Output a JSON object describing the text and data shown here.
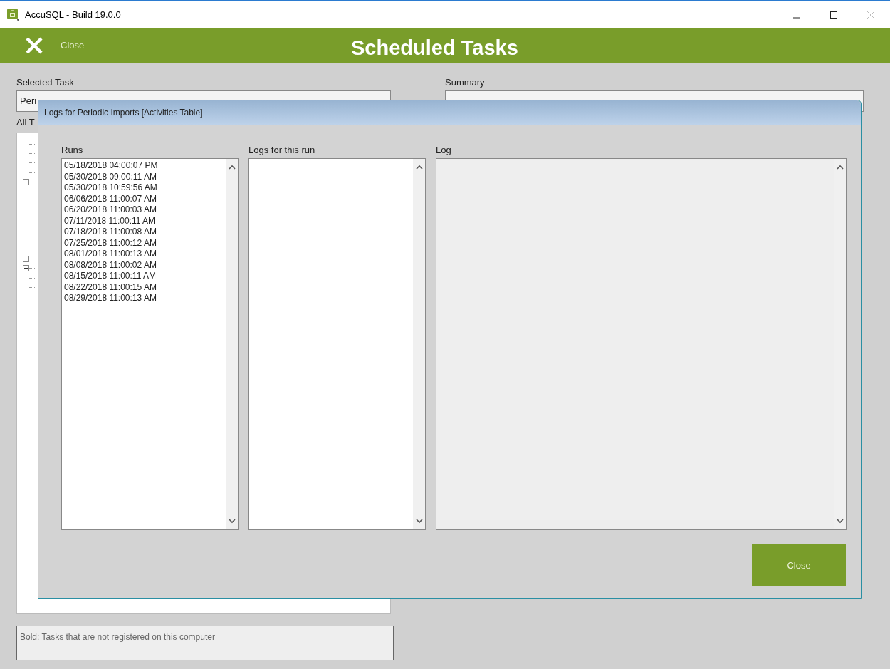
{
  "window": {
    "title": "AccuSQL - Build 19.0.0"
  },
  "header": {
    "close_label": "Close",
    "title": "Scheduled Tasks"
  },
  "selected_task": {
    "label": "Selected Task",
    "value": "Peri"
  },
  "all_tasks": {
    "label": "All T",
    "items": [
      {
        "kind": "leaf"
      },
      {
        "kind": "leaf"
      },
      {
        "kind": "leaf"
      },
      {
        "kind": "leaf"
      },
      {
        "kind": "expanded"
      },
      {
        "kind": "collapsed"
      },
      {
        "kind": "collapsed"
      },
      {
        "kind": "leaf"
      },
      {
        "kind": "leaf"
      }
    ]
  },
  "summary": {
    "label": "Summary"
  },
  "legend": "Bold: Tasks that are not registered on this computer",
  "dialog": {
    "title": "Logs for Periodic Imports [Activities Table]",
    "runs": {
      "label": "Runs",
      "items": [
        "05/18/2018 04:00:07 PM",
        "05/30/2018 09:00:11 AM",
        "05/30/2018 10:59:56 AM",
        "06/06/2018 11:00:07 AM",
        "06/20/2018 11:00:03 AM",
        "07/11/2018 11:00:11 AM",
        "07/18/2018 11:00:08 AM",
        "07/25/2018 11:00:12 AM",
        "08/01/2018 11:00:13 AM",
        "08/08/2018 11:00:02 AM",
        "08/15/2018 11:00:11 AM",
        "08/22/2018 11:00:15 AM",
        "08/29/2018 11:00:13 AM"
      ]
    },
    "logs_label": "Logs for this run",
    "log_label": "Log",
    "close_button": "Close"
  }
}
